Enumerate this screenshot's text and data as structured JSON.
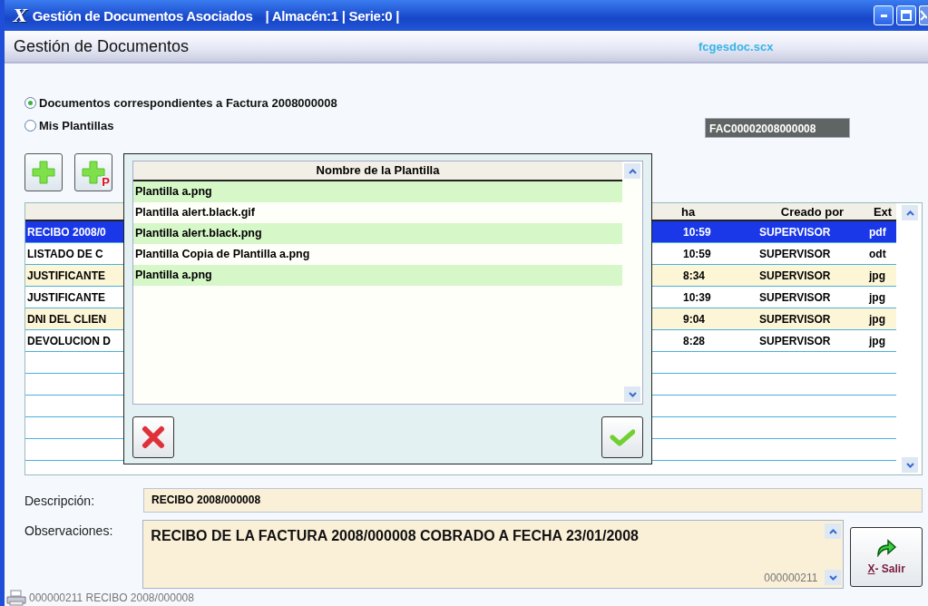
{
  "window": {
    "logo": "X",
    "title": "Gestión de Documentos Asociados",
    "context": "| Almacén:1 | Serie:0 |"
  },
  "header": {
    "title": "Gestión de Documentos",
    "form_name": "fcgesdoc.scx"
  },
  "source_options": [
    {
      "label": "Documentos correspondientes a Factura 2008000008",
      "selected": true
    },
    {
      "label": "Mis Plantillas",
      "selected": false
    }
  ],
  "reference_field": {
    "value": "FAC00002008000008"
  },
  "toolbar": [
    {
      "kind": "add"
    },
    {
      "kind": "add_template",
      "badge": "P"
    }
  ],
  "documents": {
    "columns": [
      "ha",
      "Creado por",
      "Ext"
    ],
    "rows": [
      {
        "column_1": "RECIBO 2008/0",
        "column_2": "10:59",
        "created_by": "SUPERVISOR",
        "ext": "pdf",
        "selected": true
      },
      {
        "column_1": "LISTADO DE C",
        "column_2": "10:59",
        "created_by": "SUPERVISOR",
        "ext": "odt",
        "selected": false
      },
      {
        "column_1": "JUSTIFICANTE",
        "column_2": "8:34",
        "created_by": "SUPERVISOR",
        "ext": "jpg",
        "selected": false
      },
      {
        "column_1": "JUSTIFICANTE",
        "column_2": "10:39",
        "created_by": "SUPERVISOR",
        "ext": "jpg",
        "selected": false
      },
      {
        "column_1": "DNI DEL CLIEN",
        "column_2": "9:04",
        "created_by": "SUPERVISOR",
        "ext": "jpg",
        "selected": false
      },
      {
        "column_1": "DEVOLUCION D",
        "column_2": "8:28",
        "created_by": "SUPERVISOR",
        "ext": "jpg",
        "selected": false
      }
    ]
  },
  "template_dialog": {
    "column": "Nombre de la Plantilla",
    "rows": [
      {
        "name": "Plantilla a.png"
      },
      {
        "name": "Plantilla alert.black.gif"
      },
      {
        "name": "Plantilla alert.black.png"
      },
      {
        "name": "Plantilla Copia de Plantilla a.png"
      },
      {
        "name": "Plantilla a.png"
      }
    ]
  },
  "description": {
    "label": "Descripción:",
    "value": "RECIBO 2008/000008"
  },
  "observations": {
    "label": "Observaciones:",
    "value": "RECIBO DE LA FACTURA 2008/000008 COBRADO A FECHA 23/01/2008",
    "counter": "000000211"
  },
  "exit_button": {
    "accesskey": "X",
    "label": "- Salir"
  },
  "status_bar": {
    "text": "000000211 RECIBO 2008/000008"
  }
}
